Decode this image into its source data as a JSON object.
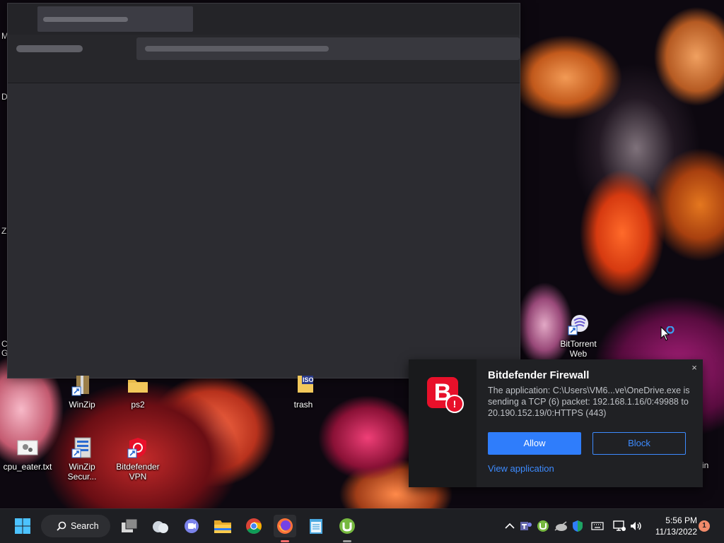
{
  "desktop": {
    "icons": [
      {
        "label": "BitTorrent Web"
      },
      {
        "label": "WinZip"
      },
      {
        "label": "ps2"
      },
      {
        "label": "trash"
      },
      {
        "label": "cpu_eater.txt"
      },
      {
        "label": "WinZip Secur..."
      },
      {
        "label": "Bitdefender VPN"
      }
    ],
    "edge_letters": [
      "M",
      "D",
      "Z",
      "C",
      "G",
      "in"
    ],
    "trash_badge": "ISO"
  },
  "notification": {
    "title": "Bitdefender Firewall",
    "body": "The application: C:\\Users\\VM6...ve\\OneDrive.exe is sending a TCP (6) packet: 192.168.1.16/0:49988 to 20.190.152.19/0:HTTPS (443)",
    "allow_label": "Allow",
    "block_label": "Block",
    "link_label": "View application",
    "close_glyph": "×",
    "logo_letter": "B",
    "logo_badge": "!",
    "colors": {
      "accent": "#2f7dfb",
      "brand": "#e8102a"
    }
  },
  "taskbar": {
    "search_label": "Search",
    "clock_time": "5:56 PM",
    "clock_date": "11/13/2022",
    "notification_count": "1",
    "pinned": [
      "start-icon",
      "task-view-icon",
      "weather-icon",
      "teams-chat-icon",
      "file-explorer-icon",
      "chrome-icon",
      "firefox-icon",
      "notepad-icon",
      "utorrent-icon"
    ],
    "tray": [
      "chevron-up-icon",
      "teams-icon",
      "bittorrent-tray-icon",
      "onedrive-icon",
      "defender-icon",
      "keyboard-icon",
      "network-icon",
      "volume-icon"
    ]
  }
}
